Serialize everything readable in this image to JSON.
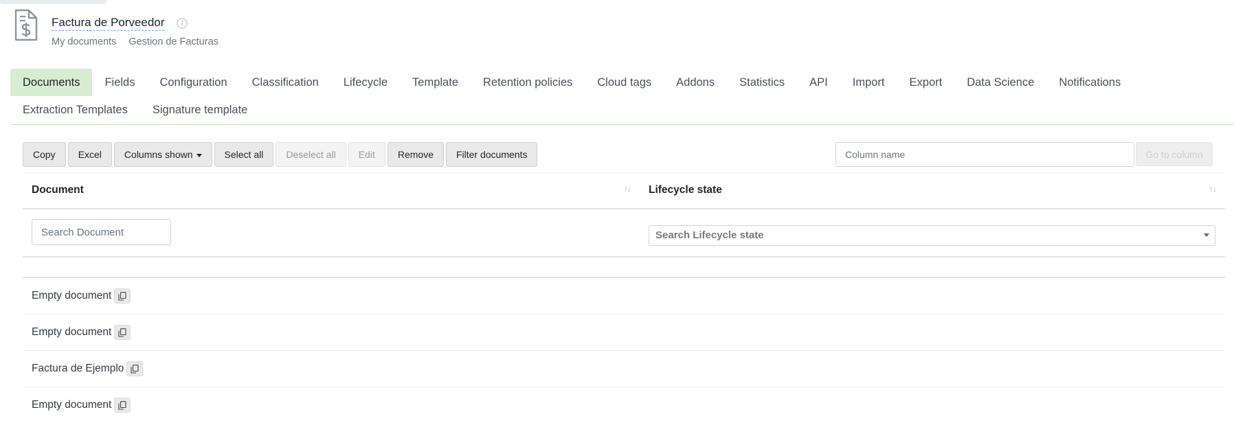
{
  "header": {
    "title": "Factura de Porveedor",
    "breadcrumbs": [
      "My documents",
      "Gestion de Facturas"
    ],
    "icon": "invoice-document-icon"
  },
  "tabs": {
    "row1": [
      "Documents",
      "Fields",
      "Configuration",
      "Classification",
      "Lifecycle",
      "Template",
      "Retention policies",
      "Cloud tags",
      "Addons",
      "Statistics",
      "API",
      "Import",
      "Export",
      "Data Science",
      "Notifications"
    ],
    "row2": [
      "Extraction Templates",
      "Signature template"
    ],
    "active": "Documents"
  },
  "toolbar": {
    "copy": "Copy",
    "excel": "Excel",
    "columns_shown": "Columns shown",
    "select_all": "Select all",
    "deselect_all": "Deselect all",
    "edit": "Edit",
    "remove": "Remove",
    "filter_documents": "Filter documents"
  },
  "column_search": {
    "placeholder": "Column name",
    "go_label": "Go to column"
  },
  "table": {
    "columns": [
      "Document",
      "Lifecycle state"
    ],
    "filters": {
      "document_placeholder": "Search Document",
      "lifecycle_placeholder": "Search Lifecycle state"
    },
    "rows": [
      {
        "document": "Empty document"
      },
      {
        "document": "Empty document"
      },
      {
        "document": "Factura de Ejemplo"
      },
      {
        "document": "Empty document"
      }
    ]
  },
  "colors": {
    "active_tab": "#d7ecd0",
    "tab_border": "#c8e0c0"
  }
}
